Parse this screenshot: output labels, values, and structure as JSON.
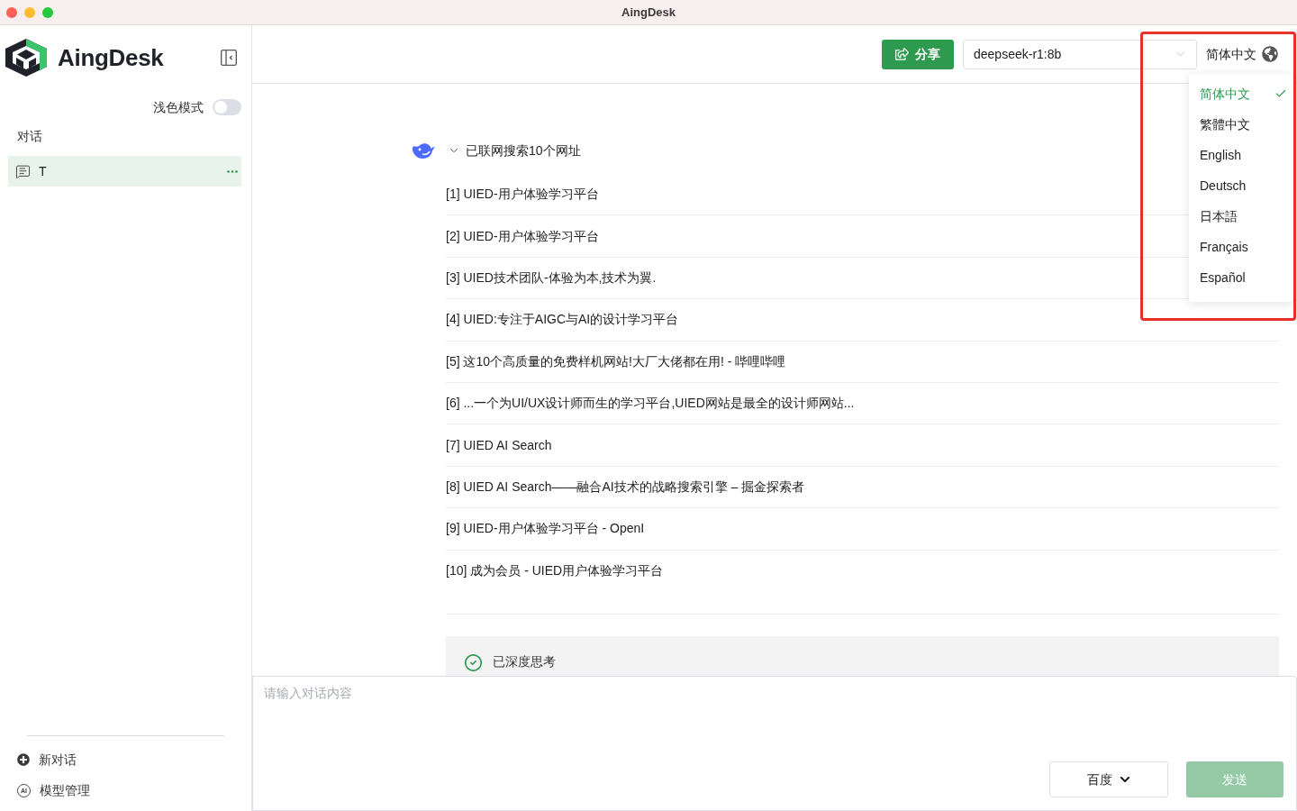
{
  "window": {
    "title": "AingDesk"
  },
  "sidebar": {
    "brand": "AingDesk",
    "theme_toggle": {
      "label": "浅色模式",
      "on": false
    },
    "section_title": "对话",
    "conversations": [
      {
        "title": "T",
        "selected": true
      }
    ],
    "footer_items": [
      {
        "kind": "new",
        "label": "新对话"
      },
      {
        "kind": "models",
        "label": "模型管理",
        "icon_text": "AI"
      }
    ]
  },
  "header": {
    "share_button": "分享",
    "model_select": {
      "value": "deepseek-r1:8b"
    },
    "language_button": "简体中文"
  },
  "language_menu": {
    "highlighted": true,
    "options": [
      {
        "label": "简体中文",
        "selected": true
      },
      {
        "label": "繁體中文",
        "selected": false
      },
      {
        "label": "English",
        "selected": false
      },
      {
        "label": "Deutsch",
        "selected": false
      },
      {
        "label": "日本語",
        "selected": false
      },
      {
        "label": "Français",
        "selected": false
      },
      {
        "label": "Español",
        "selected": false
      }
    ]
  },
  "search_result": {
    "summary": "已联网搜索10个网址",
    "expanded": true,
    "links": [
      "[1] UIED-用户体验学习平台",
      "[2] UIED-用户体验学习平台",
      "[3] UIED技术团队-体验为本,技术为翼.",
      "[4] UIED:专注于AIGC与AI的设计学习平台",
      "[5] 这10个高质量的免费样机网站!大厂大佬都在用! - 哔哩哔哩",
      "[6] ...一个为UI/UX设计师而生的学习平台,UIED网站是最全的设计师网站...",
      "[7] UIED AI Search",
      "[8] UIED AI Search——融合AI技术的战略搜索引擎 – 掘金探索者",
      "[9] UIED-用户体验学习平台 - OpenI",
      "[10] 成为会员 - UIED用户体验学习平台"
    ]
  },
  "thinking": {
    "label": "已深度思考"
  },
  "composer": {
    "placeholder": "请输入对话内容",
    "search_engine": "百度",
    "send_button": {
      "label": "发送",
      "disabled": true
    }
  }
}
